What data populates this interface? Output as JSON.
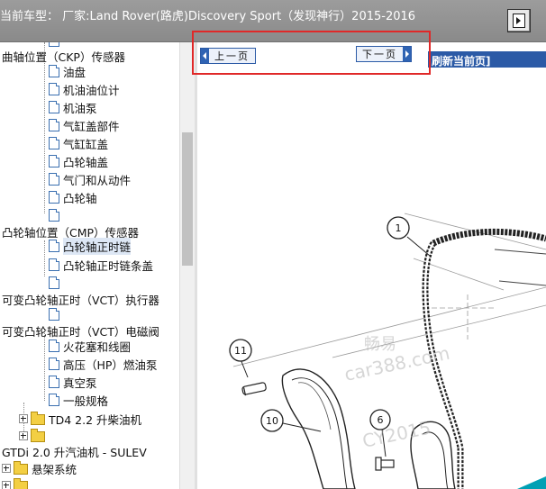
{
  "header": {
    "vehicle_label": "当前车型：  厂家:Land Rover(路虎)Discovery Sport（发现神行）2015-2016"
  },
  "nav": {
    "prev_label": "上一页",
    "next_label": "下一页",
    "refresh_label": "刷新当前页]"
  },
  "tree": {
    "items": [
      {
        "label": "",
        "icon": "document-icon"
      },
      {
        "label": "曲轴位置（CKP）传感器",
        "icon": "none"
      },
      {
        "label": "油盘",
        "icon": "document-icon"
      },
      {
        "label": "机油油位计",
        "icon": "document-icon"
      },
      {
        "label": "机油泵",
        "icon": "document-icon"
      },
      {
        "label": "气缸盖部件",
        "icon": "document-icon"
      },
      {
        "label": "气缸缸盖",
        "icon": "document-icon"
      },
      {
        "label": "凸轮轴盖",
        "icon": "document-icon"
      },
      {
        "label": "气门和从动件",
        "icon": "document-icon"
      },
      {
        "label": "凸轮轴",
        "icon": "document-icon"
      },
      {
        "label": "",
        "icon": "document-icon"
      },
      {
        "label": "凸轮轴位置（CMP）传感器",
        "icon": "none"
      },
      {
        "label": "凸轮轴正时链",
        "icon": "document-icon",
        "selected": true
      },
      {
        "label": "凸轮轴正时链条盖",
        "icon": "document-icon"
      },
      {
        "label": "",
        "icon": "document-icon"
      },
      {
        "label": "可变凸轮轴正时（VCT）执行器",
        "icon": "none"
      },
      {
        "label": "",
        "icon": "document-icon"
      },
      {
        "label": "可变凸轮轴正时（VCT）电磁阀",
        "icon": "none"
      },
      {
        "label": "火花塞和线圈",
        "icon": "document-icon"
      },
      {
        "label": "高压（HP）燃油泵",
        "icon": "document-icon"
      },
      {
        "label": "真空泵",
        "icon": "document-icon"
      },
      {
        "label": "一般规格",
        "icon": "document-icon"
      },
      {
        "label": "TD4 2.2 升柴油机",
        "icon": "folder-icon"
      },
      {
        "label": "",
        "icon": "folder-icon"
      },
      {
        "label": "GTDi 2.0 升汽油机 - SULEV",
        "icon": "none"
      },
      {
        "label": "悬架系统",
        "icon": "folder-icon"
      },
      {
        "label": "",
        "icon": "folder-icon"
      }
    ]
  },
  "diagram": {
    "callouts": [
      "1",
      "11",
      "6",
      "10"
    ],
    "watermark_lines": [
      "畅易",
      "car388.com",
      "CY2015"
    ]
  },
  "colors": {
    "header_bg": "#959595",
    "nav_band": "#2b5aa6",
    "highlight": "#e02828",
    "folder": "#f3cf43",
    "diagram_accent": "#00a0b4"
  }
}
